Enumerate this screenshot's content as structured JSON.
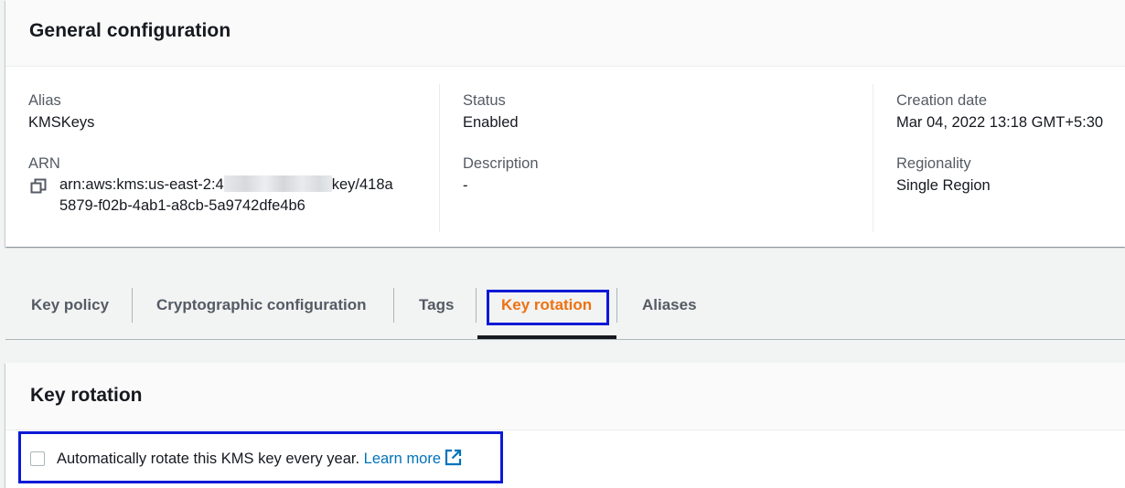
{
  "general": {
    "title": "General configuration",
    "alias_label": "Alias",
    "alias_value": "KMSKeys",
    "arn_label": "ARN",
    "arn_prefix": "arn:aws:kms:us-east-2:4",
    "arn_suffix": "key/418a",
    "arn_line2": "5879-f02b-4ab1-a8cb-5a9742dfe4b6",
    "status_label": "Status",
    "status_value": "Enabled",
    "description_label": "Description",
    "description_value": "-",
    "creation_label": "Creation date",
    "creation_value": "Mar 04, 2022 13:18 GMT+5:30",
    "regionality_label": "Regionality",
    "regionality_value": "Single Region"
  },
  "tabs": [
    {
      "label": "Key policy"
    },
    {
      "label": "Cryptographic configuration"
    },
    {
      "label": "Tags"
    },
    {
      "label": "Key rotation",
      "active": true
    },
    {
      "label": "Aliases"
    }
  ],
  "key_rotation": {
    "title": "Key rotation",
    "checkbox_label": "Automatically rotate this KMS key every year.",
    "checkbox_checked": false,
    "learn_more": "Learn more"
  },
  "colors": {
    "accent": "#ec7211",
    "link": "#0073bb",
    "highlight": "#0b19d6"
  },
  "icons": [
    "copy-icon",
    "external-link-icon"
  ]
}
